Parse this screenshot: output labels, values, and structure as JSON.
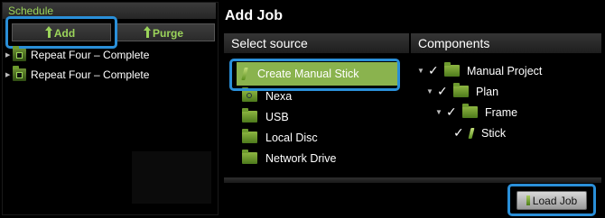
{
  "schedule": {
    "title": "Schedule",
    "add_label": "Add",
    "purge_label": "Purge",
    "items": [
      {
        "label": "Repeat Four – Complete"
      },
      {
        "label": "Repeat Four – Complete"
      }
    ]
  },
  "add_job": {
    "title": "Add Job",
    "select_source_header": "Select source",
    "components_header": "Components",
    "sources": [
      {
        "label": "Create Manual Stick",
        "icon": "stick-icon",
        "selected": true
      },
      {
        "label": "Nexa",
        "icon": "nexa-folder-icon"
      },
      {
        "label": "USB",
        "icon": "folder-icon"
      },
      {
        "label": "Local Disc",
        "icon": "folder-icon"
      },
      {
        "label": "Network Drive",
        "icon": "folder-icon"
      }
    ],
    "components": [
      {
        "label": "Manual Project",
        "checked": true,
        "icon": "folder-icon"
      },
      {
        "label": "Plan",
        "checked": true,
        "icon": "folder-icon"
      },
      {
        "label": "Frame",
        "checked": true,
        "icon": "folder-icon"
      },
      {
        "label": "Stick",
        "checked": true,
        "icon": "stick-icon"
      }
    ],
    "load_job_label": "Load Job"
  },
  "colors": {
    "accent_green": "#9bd45a",
    "selection_green": "#8ab34e",
    "highlight_blue": "#2a8fd8"
  }
}
